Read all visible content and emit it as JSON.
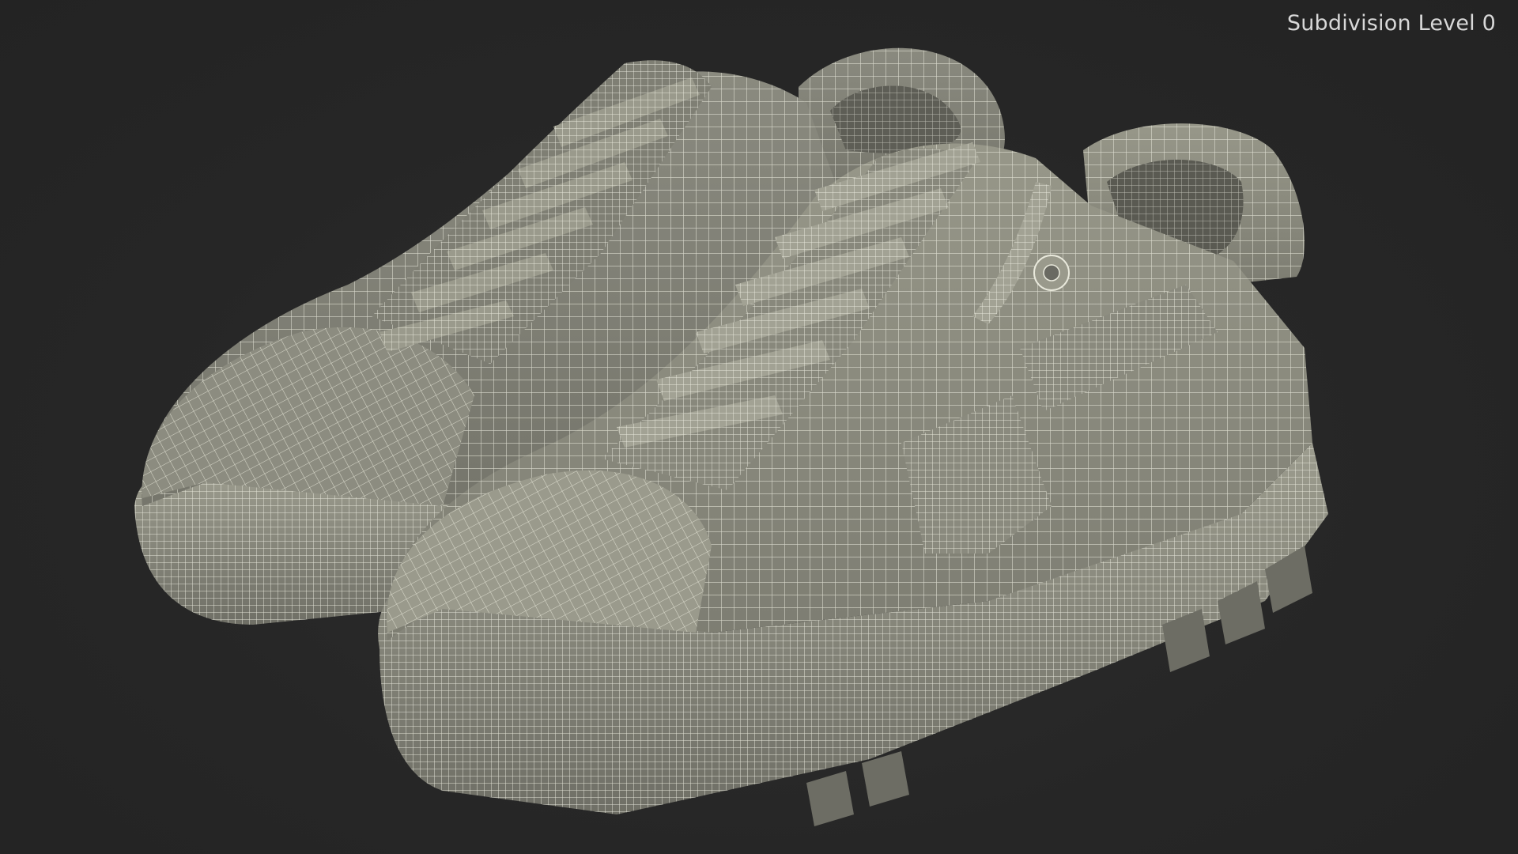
{
  "viewport": {
    "overlay_label": "Subdivision Level 0",
    "background_color": "#272727",
    "mesh_fill_color": "#8e8e82",
    "wire_color": "#e8e8da"
  },
  "model": {
    "subject": "pair of sneakers",
    "display_mode": "shaded with wireframe overlay",
    "count": 2
  }
}
